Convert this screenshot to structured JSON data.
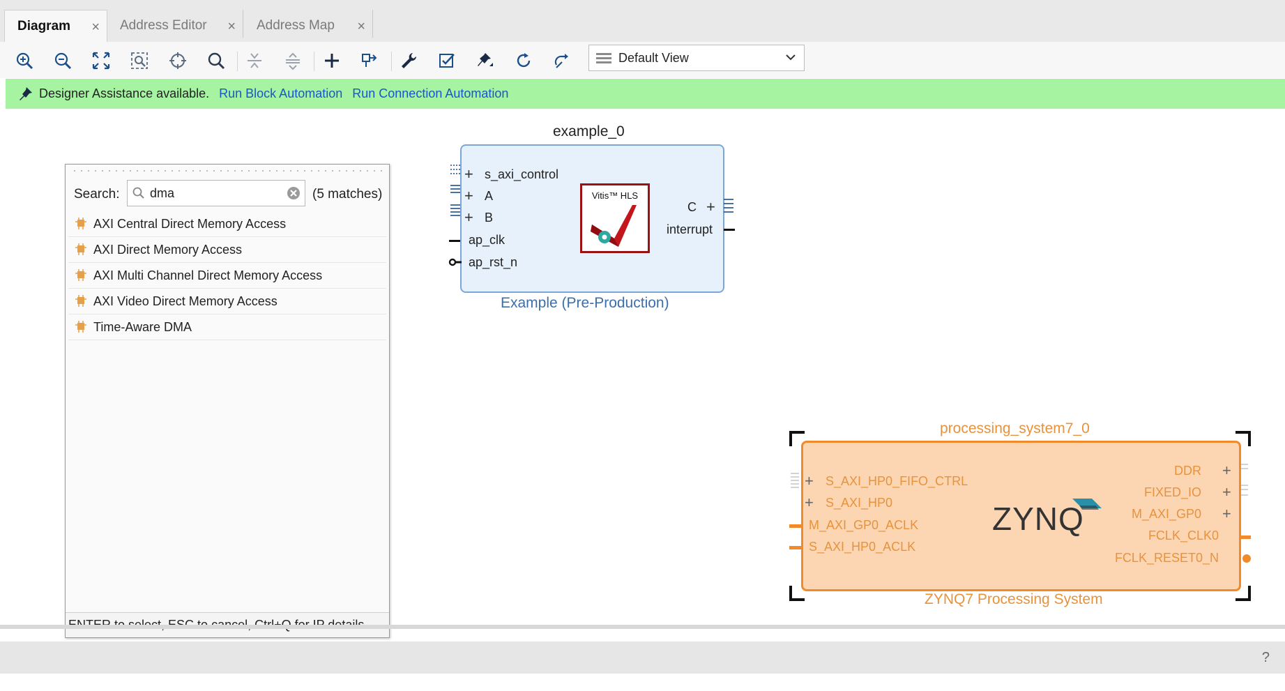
{
  "tabs": [
    {
      "label": "Diagram",
      "active": true
    },
    {
      "label": "Address Editor",
      "active": false
    },
    {
      "label": "Address Map",
      "active": false
    }
  ],
  "toolbar": {
    "icons": [
      "zoom-in-icon",
      "zoom-out-icon",
      "fit-view-icon",
      "zoom-selection-icon",
      "center-icon",
      "search-icon",
      "collapse-icon",
      "expand-icon",
      "add-ip-icon",
      "make-external-icon",
      "properties-icon",
      "validate-icon",
      "pin-icon",
      "refresh-icon",
      "regenerate-layout-icon"
    ],
    "view_select": "Default View"
  },
  "assist": {
    "text": "Designer Assistance available.",
    "link_block": "Run Block Automation",
    "link_connection": "Run Connection Automation"
  },
  "popup": {
    "search_label": "Search:",
    "search_value": "dma",
    "matches": "(5 matches)",
    "items": [
      "AXI Central Direct Memory Access",
      "AXI Direct Memory Access",
      "AXI Multi Channel Direct Memory Access",
      "AXI Video Direct Memory Access",
      "Time-Aware DMA"
    ],
    "footer": "ENTER to select, ESC to cancel, Ctrl+Q for IP details"
  },
  "example_block": {
    "instance": "example_0",
    "subtitle": "Example (Pre-Production)",
    "logo_text": "Vitis™ HLS",
    "inputs": [
      "s_axi_control",
      "A",
      "B",
      "ap_clk",
      "ap_rst_n"
    ],
    "outputs": [
      "C",
      "interrupt"
    ]
  },
  "zynq_block": {
    "instance": "processing_system7_0",
    "subtitle": "ZYNQ7 Processing System",
    "logo": "ZYNQ",
    "inputs": [
      "S_AXI_HP0_FIFO_CTRL",
      "S_AXI_HP0",
      "M_AXI_GP0_ACLK",
      "S_AXI_HP0_ACLK"
    ],
    "outputs": [
      "DDR",
      "FIXED_IO",
      "M_AXI_GP0",
      "FCLK_CLK0",
      "FCLK_RESET0_N"
    ]
  },
  "help": "?",
  "colors": {
    "assist_bg": "#a6f3a2",
    "link": "#1a56c9",
    "zynq_fill": "#fcd6b2",
    "zynq_border": "#f08a2a",
    "block_fill": "#e7f1fb"
  }
}
